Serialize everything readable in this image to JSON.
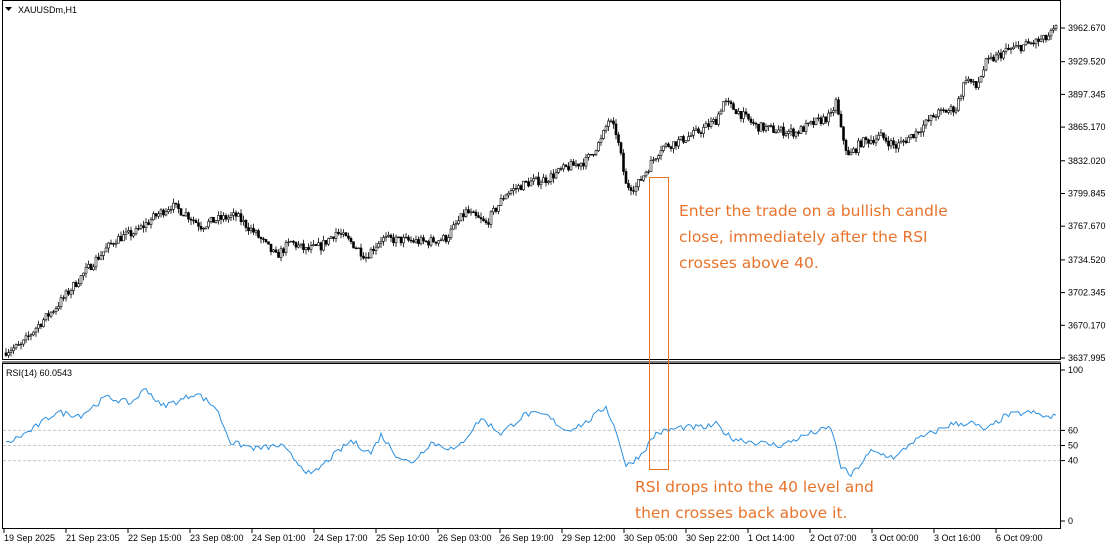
{
  "chart_data": [
    {
      "type": "candlestick",
      "label": "XAUUSDm,H1",
      "ylim": [
        3637.995,
        3962.67
      ],
      "y_ticks": [
        "3962.670",
        "3929.520",
        "3897.345",
        "3865.170",
        "3832.020",
        "3799.845",
        "3767.670",
        "3734.520",
        "3702.345",
        "3670.170",
        "3637.995"
      ],
      "x_ticks": [
        "19 Sep 2025",
        "21 Sep 23:05",
        "22 Sep 15:00",
        "23 Sep 08:00",
        "24 Sep 01:00",
        "24 Sep 17:00",
        "25 Sep 10:00",
        "26 Sep 03:00",
        "26 Sep 19:00",
        "29 Sep 12:00",
        "30 Sep 05:00",
        "30 Sep 22:00",
        "1 Oct 14:00",
        "2 Oct 07:00",
        "3 Oct 00:00",
        "3 Oct 16:00",
        "6 Oct 09:00"
      ],
      "close_anchors": [
        [
          0,
          3645
        ],
        [
          6,
          3650
        ],
        [
          12,
          3668
        ],
        [
          20,
          3688
        ],
        [
          28,
          3712
        ],
        [
          36,
          3735
        ],
        [
          44,
          3755
        ],
        [
          52,
          3762
        ],
        [
          60,
          3778
        ],
        [
          66,
          3788
        ],
        [
          72,
          3780
        ],
        [
          78,
          3768
        ],
        [
          84,
          3774
        ],
        [
          92,
          3778
        ],
        [
          100,
          3760
        ],
        [
          108,
          3738
        ],
        [
          114,
          3752
        ],
        [
          120,
          3744
        ],
        [
          126,
          3748
        ],
        [
          132,
          3762
        ],
        [
          138,
          3752
        ],
        [
          144,
          3738
        ],
        [
          150,
          3755
        ],
        [
          158,
          3754
        ],
        [
          168,
          3752
        ],
        [
          176,
          3756
        ],
        [
          184,
          3782
        ],
        [
          192,
          3770
        ],
        [
          200,
          3800
        ],
        [
          208,
          3810
        ],
        [
          216,
          3814
        ],
        [
          224,
          3825
        ],
        [
          232,
          3832
        ],
        [
          238,
          3852
        ],
        [
          241,
          3872
        ],
        [
          244,
          3860
        ],
        [
          246,
          3836
        ],
        [
          248,
          3808
        ],
        [
          252,
          3806
        ],
        [
          256,
          3822
        ],
        [
          262,
          3845
        ],
        [
          270,
          3852
        ],
        [
          278,
          3862
        ],
        [
          284,
          3872
        ],
        [
          287,
          3890
        ],
        [
          292,
          3882
        ],
        [
          300,
          3866
        ],
        [
          308,
          3862
        ],
        [
          316,
          3860
        ],
        [
          324,
          3870
        ],
        [
          330,
          3876
        ],
        [
          332,
          3890
        ],
        [
          334,
          3862
        ],
        [
          337,
          3836
        ],
        [
          342,
          3850
        ],
        [
          350,
          3856
        ],
        [
          356,
          3846
        ],
        [
          364,
          3860
        ],
        [
          372,
          3878
        ],
        [
          380,
          3884
        ],
        [
          384,
          3914
        ],
        [
          388,
          3904
        ],
        [
          392,
          3928
        ],
        [
          400,
          3940
        ],
        [
          408,
          3946
        ],
        [
          416,
          3952
        ],
        [
          420,
          3962
        ]
      ]
    },
    {
      "type": "line",
      "label": "RSI(14) 60.0543",
      "series": [
        {
          "values_anchor": [
            [
              0,
              51
            ],
            [
              10,
              60
            ],
            [
              20,
              72
            ],
            [
              30,
              70
            ],
            [
              40,
              82
            ],
            [
              50,
              78
            ],
            [
              56,
              88
            ],
            [
              62,
              76
            ],
            [
              70,
              80
            ],
            [
              76,
              85
            ],
            [
              84,
              75
            ],
            [
              90,
              52
            ],
            [
              100,
              48
            ],
            [
              110,
              50
            ],
            [
              116,
              40
            ],
            [
              122,
              30
            ],
            [
              130,
              42
            ],
            [
              138,
              53
            ],
            [
              146,
              45
            ],
            [
              150,
              57
            ],
            [
              156,
              44
            ],
            [
              162,
              38
            ],
            [
              170,
              52
            ],
            [
              180,
              47
            ],
            [
              190,
              68
            ],
            [
              198,
              58
            ],
            [
              208,
              71
            ],
            [
              216,
              70
            ],
            [
              224,
              60
            ],
            [
              232,
              65
            ],
            [
              240,
              76
            ],
            [
              245,
              55
            ],
            [
              248,
              36
            ],
            [
              254,
              44
            ],
            [
              260,
              58
            ],
            [
              270,
              62
            ],
            [
              280,
              62
            ],
            [
              284,
              64
            ],
            [
              290,
              55
            ],
            [
              300,
              52
            ],
            [
              310,
              50
            ],
            [
              320,
              57
            ],
            [
              330,
              62
            ],
            [
              334,
              36
            ],
            [
              338,
              30
            ],
            [
              346,
              46
            ],
            [
              356,
              42
            ],
            [
              362,
              52
            ],
            [
              370,
              58
            ],
            [
              378,
              64
            ],
            [
              386,
              65
            ],
            [
              392,
              60
            ],
            [
              400,
              70
            ],
            [
              410,
              72
            ],
            [
              418,
              68
            ],
            [
              424,
              74
            ]
          ]
        }
      ],
      "ylim": [
        0,
        100
      ],
      "levels": [
        40,
        50,
        60
      ],
      "right_axis_labels": [
        "100",
        "60",
        "50",
        "40",
        "0"
      ]
    }
  ],
  "annotations": {
    "trade_lines": [
      "Enter the trade on a bullish candle",
      "close, immediately after the RSI",
      "crosses above 40."
    ],
    "rsi_lines": [
      "RSI drops into the 40 level and",
      "then crosses back above it."
    ]
  },
  "colors": {
    "candle_bull": "#ffffff",
    "candle_bear": "#000000",
    "rsi_line": "#2a8fe0",
    "annotation": "#e8742c",
    "level_line": "#c8c8c8",
    "frame": "#000000"
  }
}
